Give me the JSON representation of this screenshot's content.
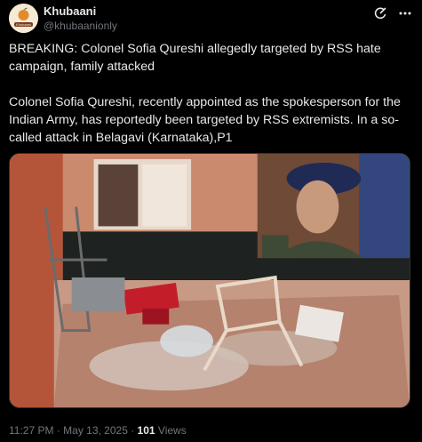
{
  "author": {
    "display_name": "Khubaani",
    "handle": "@khubaanionly",
    "avatar_text": "Khubaani"
  },
  "tweet": {
    "text": "BREAKING: Colonel Sofia Qureshi allegedly targeted by RSS hate campaign, family attacked\n\nColonel Sofia Qureshi, recently appointed as the spokesperson for the Indian Army, has reportedly been targeted by RSS extremists. In a so-called attack in Belagavi (Karnataka),P1"
  },
  "meta": {
    "time": "11:27 PM",
    "separator": " · ",
    "date": "May 13, 2025",
    "views_count": "101",
    "views_label": " Views"
  },
  "icons": {
    "grok": "grok-icon",
    "more": "more-icon"
  },
  "colors": {
    "background": "#000000",
    "text": "#e7e9ea",
    "secondary": "#71767b",
    "border": "#2f3336"
  }
}
